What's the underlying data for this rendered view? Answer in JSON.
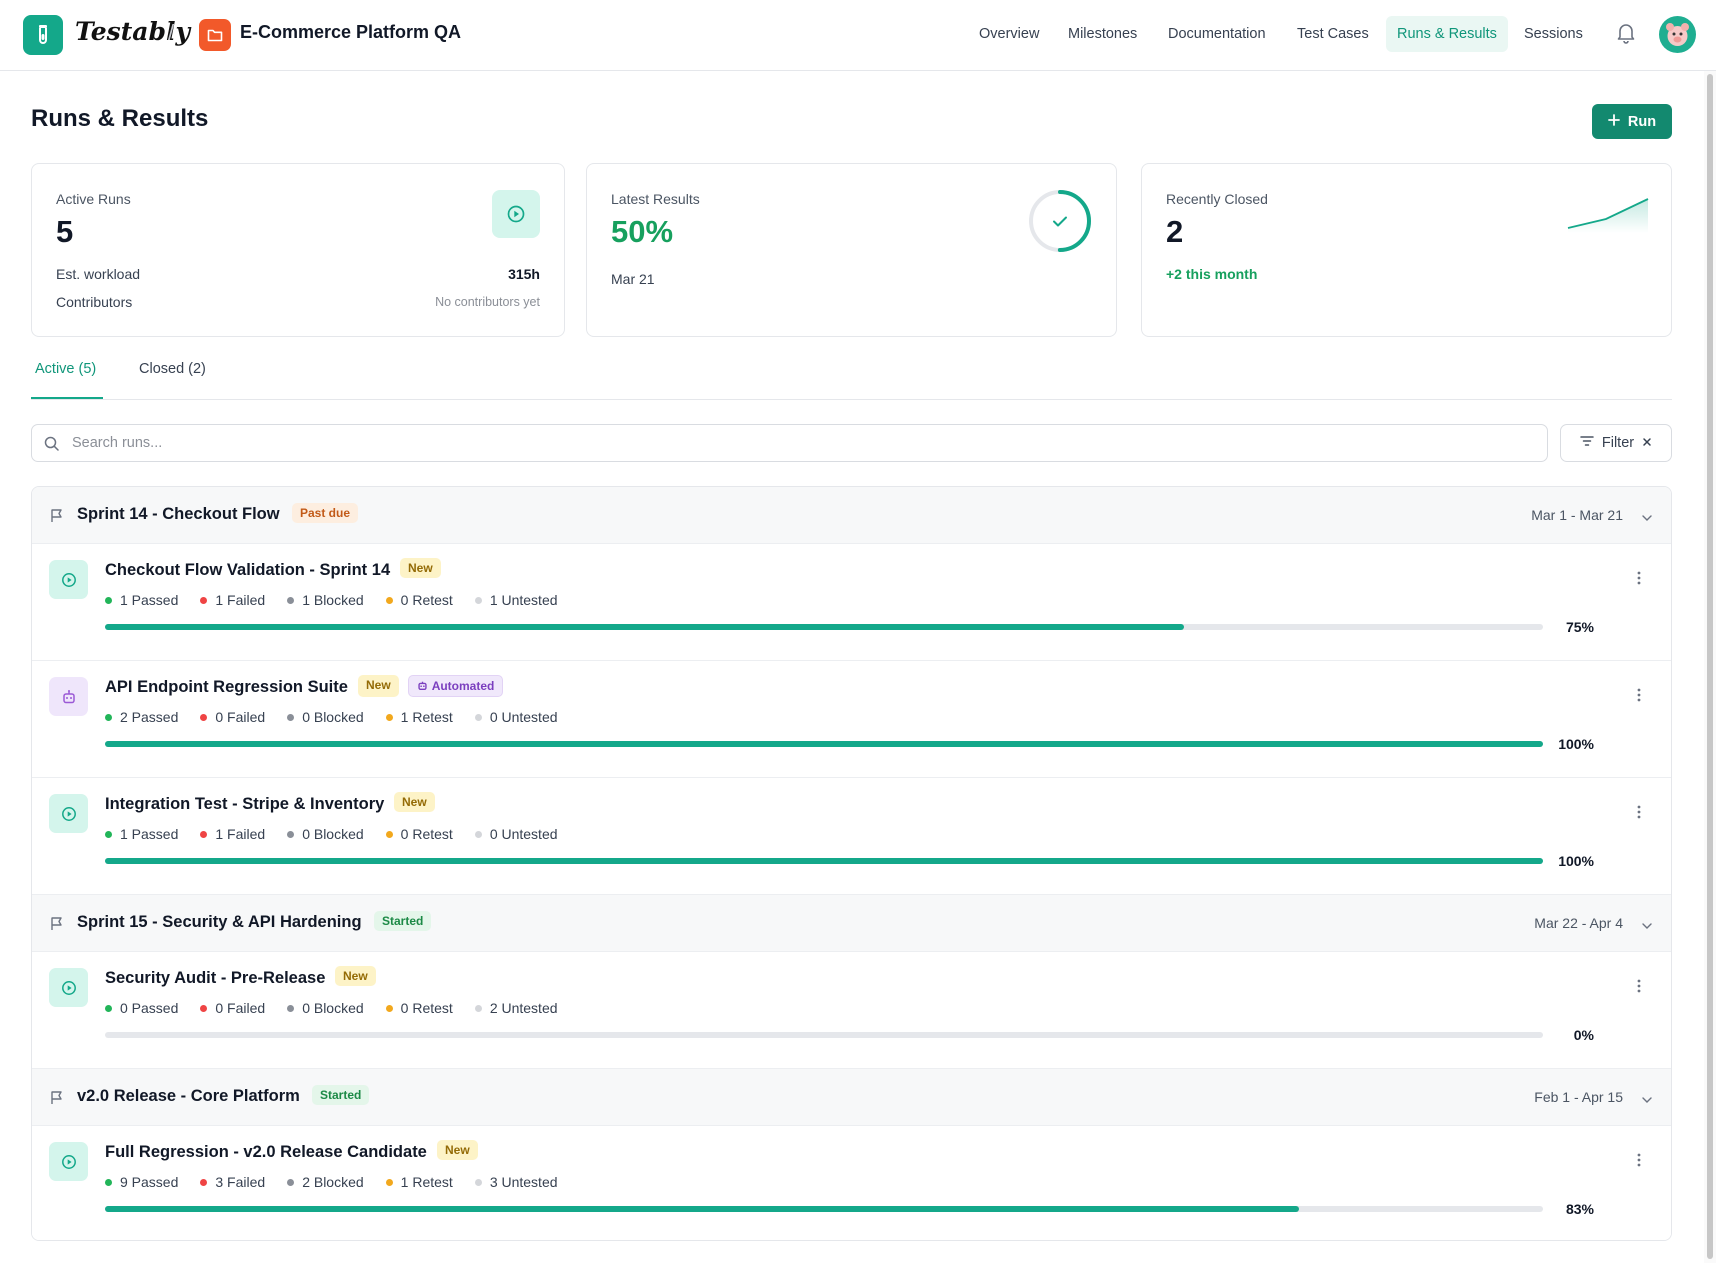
{
  "header": {
    "brand": "Testably",
    "project": "E-Commerce Platform QA",
    "nav": [
      {
        "label": "Overview"
      },
      {
        "label": "Milestones"
      },
      {
        "label": "Documentation"
      },
      {
        "label": "Test Cases"
      },
      {
        "label": "Runs & Results"
      },
      {
        "label": "Sessions"
      }
    ],
    "active_nav": "Runs & Results"
  },
  "page": {
    "title": "Runs & Results",
    "new_run_label": "Run"
  },
  "cards": {
    "active_runs": {
      "label": "Active Runs",
      "value": "5",
      "workload_label": "Est. workload",
      "workload_value": "315h",
      "contributors_label": "Contributors",
      "contributors_value": "No contributors yet"
    },
    "latest_results": {
      "label": "Latest Results",
      "value": "50%",
      "progress": 0.5,
      "date": "Mar 21"
    },
    "recently_closed": {
      "label": "Recently Closed",
      "value": "2",
      "delta": "+2 this month"
    }
  },
  "tabs": [
    {
      "label": "Active (5)",
      "active": true
    },
    {
      "label": "Closed (2)",
      "active": false
    }
  ],
  "search": {
    "placeholder": "Search runs...",
    "value": ""
  },
  "filter_label": "Filter",
  "stat_labels": {
    "passed": "Passed",
    "failed": "Failed",
    "blocked": "Blocked",
    "retest": "Retest",
    "untested": "Untested"
  },
  "groups": [
    {
      "title": "Sprint 14 - Checkout Flow",
      "badge": "Past due",
      "dates": "Mar 1 - Mar 21",
      "runs": [
        {
          "title": "Checkout Flow Validation - Sprint 14",
          "badges": [
            "New"
          ],
          "icon": "play-icon",
          "passed": "1 Passed",
          "failed": "1 Failed",
          "blocked": "1 Blocked",
          "retest": "0 Retest",
          "untested": "1 Untested",
          "percent": "75%",
          "progress": 0.75
        },
        {
          "title": "API Endpoint Regression Suite",
          "badges": [
            "New",
            "Automated"
          ],
          "icon": "robot-icon",
          "passed": "2 Passed",
          "failed": "0 Failed",
          "blocked": "0 Blocked",
          "retest": "1 Retest",
          "untested": "0 Untested",
          "percent": "100%",
          "progress": 1.0
        },
        {
          "title": "Integration Test - Stripe & Inventory",
          "badges": [
            "New"
          ],
          "icon": "play-icon",
          "passed": "1 Passed",
          "failed": "1 Failed",
          "blocked": "0 Blocked",
          "retest": "0 Retest",
          "untested": "0 Untested",
          "percent": "100%",
          "progress": 1.0
        }
      ]
    },
    {
      "title": "Sprint 15 - Security & API Hardening",
      "badge": "Started",
      "dates": "Mar 22 - Apr 4",
      "runs": [
        {
          "title": "Security Audit - Pre-Release",
          "badges": [
            "New"
          ],
          "icon": "play-icon",
          "passed": "0 Passed",
          "failed": "0 Failed",
          "blocked": "0 Blocked",
          "retest": "0 Retest",
          "untested": "2 Untested",
          "percent": "0%",
          "progress": 0.0
        }
      ]
    },
    {
      "title": "v2.0 Release - Core Platform",
      "badge": "Started",
      "dates": "Feb 1 - Apr 15",
      "runs": [
        {
          "title": "Full Regression - v2.0 Release Candidate",
          "badges": [
            "New"
          ],
          "icon": "play-icon",
          "passed": "9 Passed",
          "failed": "3 Failed",
          "blocked": "2 Blocked",
          "retest": "1 Retest",
          "untested": "3 Untested",
          "percent": "83%",
          "progress": 0.83
        }
      ]
    }
  ],
  "colors": {
    "accent": "#14a88a",
    "primary_button": "#13896f",
    "project_icon": "#f2592a",
    "passed": "#22b559",
    "failed": "#ef4444",
    "blocked": "#8a8f98",
    "retest": "#f2a81d",
    "untested": "#d4d6da"
  }
}
